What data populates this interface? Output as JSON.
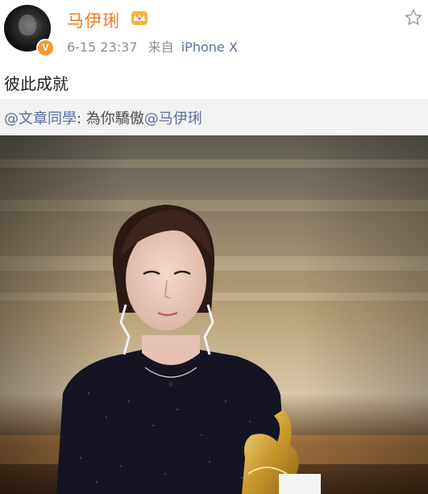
{
  "post": {
    "author": {
      "name": "马伊琍",
      "verified_badge": "V",
      "vip_icon": "crown-icon"
    },
    "timestamp": "6-15 23:37",
    "via_label": "来自",
    "device": "iPhone X",
    "text": "彼此成就",
    "favorite_icon": "star-icon"
  },
  "repost": {
    "mention_author": "@文章同學",
    "separator": ": ",
    "body": "為你驕傲",
    "mention_target": "@马伊琍"
  },
  "colors": {
    "username": "#ee7b24",
    "link": "#5a6ea2",
    "meta": "#8f8f8f",
    "repost_bg": "#f2f2f2",
    "badge": "#f09a3a"
  }
}
